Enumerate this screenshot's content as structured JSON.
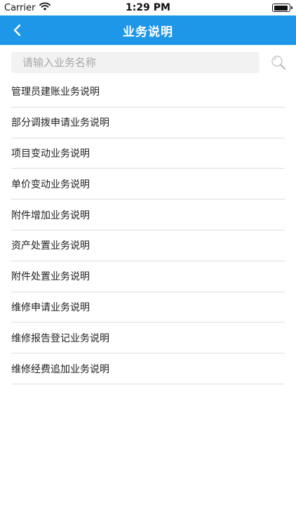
{
  "status_bar": {
    "carrier": "Carrier",
    "time": "1:29 PM"
  },
  "nav": {
    "title": "业务说明"
  },
  "search": {
    "placeholder": "请输入业务名称",
    "value": ""
  },
  "items": [
    "管理员建账业务说明",
    "部分调拨申请业务说明",
    "项目变动业务说明",
    "单价变动业务说明",
    "附件增加业务说明",
    "资产处置业务说明",
    "附件处置业务说明",
    "维修申请业务说明",
    "维修报告登记业务说明",
    "维修经费追加业务说明"
  ],
  "colors": {
    "nav_background": "#1f97e8",
    "search_background": "#f2f2f2",
    "divider": "#dedede"
  }
}
